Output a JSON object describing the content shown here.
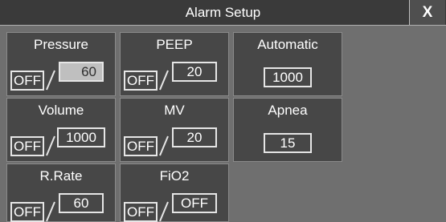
{
  "window": {
    "title": "Alarm Setup",
    "close_label": "X"
  },
  "cells": {
    "pressure": {
      "label": "Pressure",
      "off": "OFF",
      "value": "60"
    },
    "peep": {
      "label": "PEEP",
      "off": "OFF",
      "value": "20"
    },
    "automatic": {
      "label": "Automatic",
      "value": "1000"
    },
    "volume": {
      "label": "Volume",
      "off": "OFF",
      "value": "1000"
    },
    "mv": {
      "label": "MV",
      "off": "OFF",
      "value": "20"
    },
    "apnea": {
      "label": "Apnea",
      "value": "15"
    },
    "rrate": {
      "label": "R.Rate",
      "off": "OFF",
      "value": "60"
    },
    "fio2": {
      "label": "FiO2",
      "off": "OFF",
      "value": "OFF"
    }
  },
  "colors": {
    "background": "#6f6f6f",
    "cell": "#474747",
    "titlebar": "#3a3a3a",
    "selected_value": "#bfbfbf"
  }
}
